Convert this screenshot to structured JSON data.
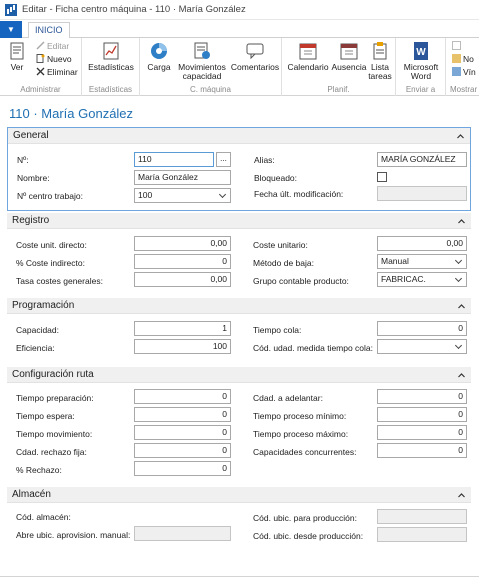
{
  "window": {
    "title": "Editar - Ficha centro máquina - 110 · María González"
  },
  "ribbon": {
    "tab": "INICIO",
    "groups": {
      "administrar": {
        "label": "Administrar",
        "ver": "Ver",
        "editar": "Editar",
        "nuevo": "Nuevo",
        "eliminar": "Eliminar"
      },
      "estadisticas": {
        "label": "Estadísticas",
        "estadisticas": "Estadísticas"
      },
      "cmaquina": {
        "label": "C. máquina",
        "carga": "Carga",
        "movimientos_1": "Movimientos",
        "movimientos_2": "capacidad",
        "comentarios": "Comentarios"
      },
      "planif": {
        "label": "Planif.",
        "calendario": "Calendario",
        "ausencia": "Ausencia",
        "lista_1": "Lista",
        "lista_2": "tareas"
      },
      "enviar": {
        "label": "Enviar a",
        "word_1": "Microsoft",
        "word_2": "Word"
      },
      "mostrar": {
        "label": "Mostrar",
        "item1": "No",
        "item2": "Vín"
      }
    }
  },
  "page": {
    "title": "110 · María González"
  },
  "general": {
    "title": "General",
    "no_label": "Nº:",
    "no_value": "110",
    "assist": "...",
    "nombre_label": "Nombre:",
    "nombre_value": "María González",
    "centro_label": "Nº centro trabajo:",
    "centro_value": "100",
    "alias_label": "Alias:",
    "alias_value": "MARÍA GONZÁLEZ",
    "bloqueado_label": "Bloqueado:",
    "bloqueado_checked": false,
    "fecha_label": "Fecha últ. modificación:",
    "fecha_value": ""
  },
  "registro": {
    "title": "Registro",
    "coste_directo_label": "Coste unit. directo:",
    "coste_directo_value": "0,00",
    "coste_indirecto_label": "% Coste indirecto:",
    "coste_indirecto_value": "0",
    "tasa_label": "Tasa costes generales:",
    "tasa_value": "0,00",
    "coste_unitario_label": "Coste unitario:",
    "coste_unitario_value": "0,00",
    "metodo_label": "Método de baja:",
    "metodo_value": "Manual",
    "grupo_label": "Grupo contable producto:",
    "grupo_value": "FABRICAC."
  },
  "programacion": {
    "title": "Programación",
    "capacidad_label": "Capacidad:",
    "capacidad_value": "1",
    "eficiencia_label": "Eficiencia:",
    "eficiencia_value": "100",
    "tiempo_cola_label": "Tiempo cola:",
    "tiempo_cola_value": "0",
    "udad_label": "Cód. udad. medida tiempo cola:",
    "udad_value": ""
  },
  "configuracion": {
    "title": "Configuración ruta",
    "prep_label": "Tiempo preparación:",
    "prep_value": "0",
    "espera_label": "Tiempo espera:",
    "espera_value": "0",
    "mov_label": "Tiempo movimiento:",
    "mov_value": "0",
    "rechazo_label": "Cdad. rechazo fija:",
    "rechazo_value": "0",
    "pct_rechazo_label": "% Rechazo:",
    "pct_rechazo_value": "0",
    "adelantar_label": "Cdad. a adelantar:",
    "adelantar_value": "0",
    "min_label": "Tiempo proceso mínimo:",
    "min_value": "0",
    "max_label": "Tiempo proceso máximo:",
    "max_value": "0",
    "conc_label": "Capacidades concurrentes:",
    "conc_value": "0"
  },
  "almacen": {
    "title": "Almacén",
    "cod_alm_label": "Cód. almacén:",
    "cod_alm_value": "",
    "abre_label": "Abre ubic. aprovision. manual:",
    "abre_value": "",
    "prod_label": "Cód. ubic. para producción:",
    "prod_value": "",
    "desde_label": "Cód. ubic. desde producción:",
    "desde_value": ""
  },
  "colors": {
    "accent": "#1f6fb2",
    "menu": "#1565c0",
    "section_bg": "#f0f0f0"
  }
}
